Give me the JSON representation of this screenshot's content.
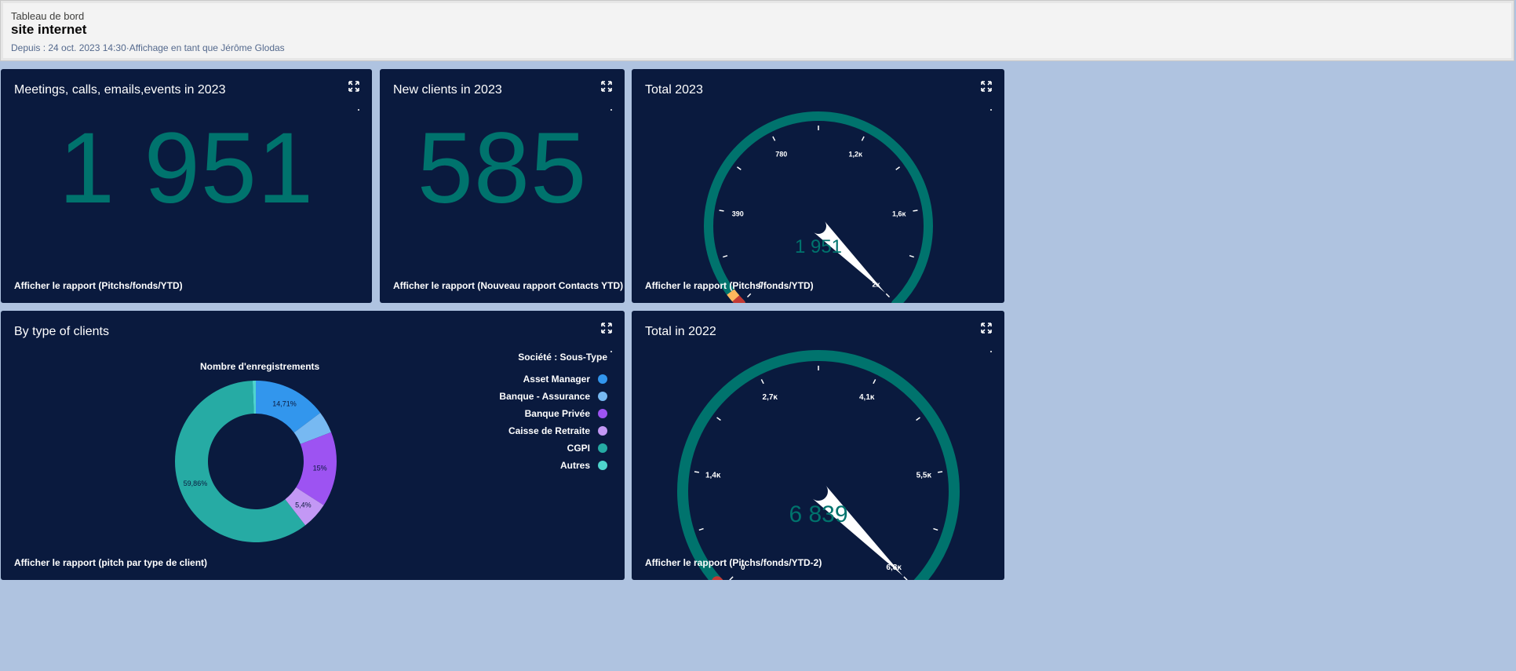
{
  "header": {
    "breadcrumb": "Tableau de bord",
    "title": "site internet",
    "meta": "Depuis : 24 oct. 2023 14:30·Affichage en tant que Jérôme Glodas"
  },
  "widgets": {
    "meetings": {
      "title": "Meetings, calls, emails,events in 2023",
      "value": "1 951",
      "link": "Afficher le rapport (Pitchs/fonds/YTD)"
    },
    "new_clients": {
      "title": "New clients in 2023",
      "value": "585",
      "link": "Afficher le rapport (Nouveau rapport Contacts YTD)"
    },
    "total_2023": {
      "title": "Total 2023",
      "value_label": "1 951",
      "link": "Afficher le rapport (Pitchs/fonds/YTD)"
    },
    "by_type": {
      "title": "By type of clients",
      "link": "Afficher le rapport (pitch par type de client)"
    },
    "total_2022": {
      "title": "Total in 2022",
      "value_label": "6 839",
      "link": "Afficher le rapport (Pitchs/fonds/YTD-2)"
    }
  },
  "chart_data": [
    {
      "type": "gauge",
      "widget": "total_2023",
      "min": 0,
      "max": 1951,
      "value": 1951,
      "tick_labels": [
        "0",
        "390",
        "780",
        "1,2ĸ",
        "1,6ĸ",
        "2ĸ"
      ],
      "colors": {
        "track": "#00736d",
        "low": "#c23934",
        "warn": "#ffb75d",
        "needle": "#ffffff",
        "value": "#00736d"
      }
    },
    {
      "type": "pie",
      "widget": "by_type",
      "subtitle": "Nombre d'enregistrements",
      "legend_title": "Société : Sous-Type",
      "legend_position": "right",
      "labels": [
        "Asset Manager",
        "Banque - Assurance",
        "Banque Privée",
        "Caisse de Retraite",
        "CGPI",
        "Autres"
      ],
      "values": [
        14.71,
        4.4,
        15,
        5.4,
        59.86,
        0.63
      ],
      "data_labels": [
        "14,71%",
        "",
        "15%",
        "5,4%",
        "59,86%",
        ""
      ],
      "colors": [
        "#3296ed",
        "#77b9f2",
        "#9d53f2",
        "#c398f5",
        "#26aba4",
        "#4ed4cd"
      ]
    },
    {
      "type": "gauge",
      "widget": "total_2022",
      "min": 0,
      "max": 6839,
      "value": 6839,
      "tick_labels": [
        "0",
        "1,4ĸ",
        "2,7ĸ",
        "4,1ĸ",
        "5,5ĸ",
        "6,8ĸ"
      ],
      "colors": {
        "track": "#00736d",
        "low": "#c23934",
        "needle": "#ffffff",
        "value": "#00736d"
      }
    }
  ]
}
